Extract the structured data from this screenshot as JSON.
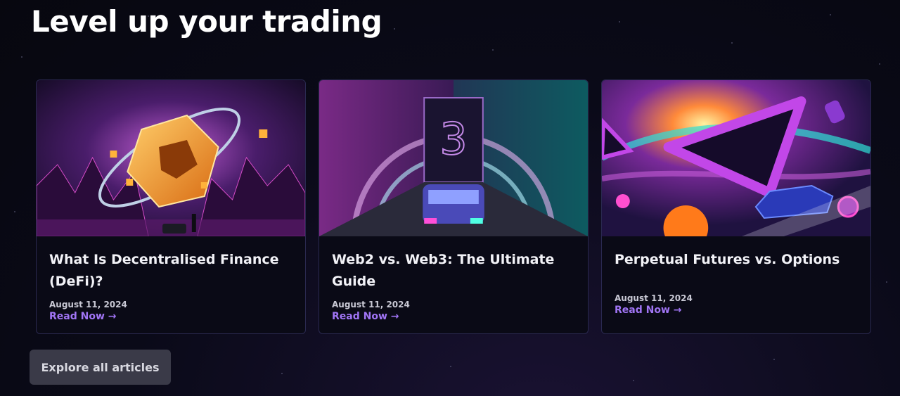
{
  "page": {
    "heading": "Level up your trading",
    "explore_label": "Explore all articles"
  },
  "articles": [
    {
      "title": "What Is Decentralised Finance (DeFi)?",
      "date": "August 11, 2024",
      "cta": "Read Now →",
      "art": "defi-illustration"
    },
    {
      "title": "Web2 vs. Web3: The Ultimate Guide",
      "date": "August 11, 2024",
      "cta": "Read Now →",
      "art": "web3-illustration"
    },
    {
      "title": "Perpetual Futures vs. Options",
      "date": "August 11, 2024",
      "cta": "Read Now →",
      "art": "futures-illustration"
    }
  ],
  "colors": {
    "accent": "#a175f5",
    "background": "#0a0a18",
    "card_border": "#2a2950",
    "button_bg": "#3a3a48"
  }
}
